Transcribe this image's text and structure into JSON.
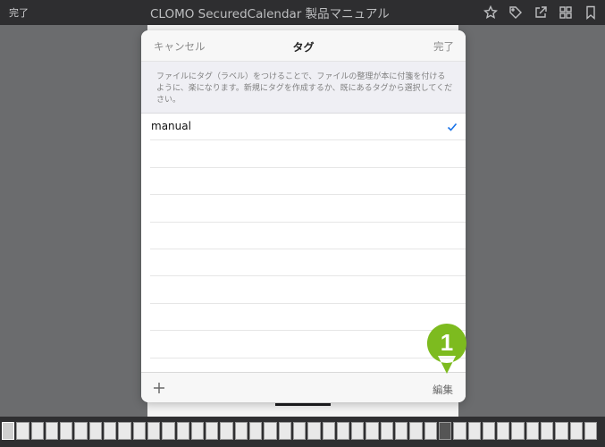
{
  "topbar": {
    "done_label": "完了",
    "title": "CLOMO SecuredCalendar 製品マニュアル",
    "icons": [
      "star-icon",
      "tag-icon",
      "share-icon",
      "grid-icon",
      "bookmark-icon"
    ]
  },
  "modal": {
    "cancel_label": "キャンセル",
    "title": "タグ",
    "done_label": "完了",
    "description": "ファイルにタグ（ラベル）をつけることで、ファイルの整理が本に付箋を付けるように、楽になります。新規にタグを作成するか、既にあるタグから選択してください。",
    "tags": [
      {
        "label": "manual",
        "checked": true
      },
      {
        "label": "",
        "checked": false
      },
      {
        "label": "",
        "checked": false
      },
      {
        "label": "",
        "checked": false
      },
      {
        "label": "",
        "checked": false
      },
      {
        "label": "",
        "checked": false
      },
      {
        "label": "",
        "checked": false
      },
      {
        "label": "",
        "checked": false
      },
      {
        "label": "",
        "checked": false
      }
    ],
    "add_icon": "plus-icon",
    "edit_label": "編集"
  },
  "annotation": {
    "number": "1",
    "color": "#7dbb1f"
  },
  "colors": {
    "check": "#1a73e8",
    "toolbar": "#2e2e30",
    "backdrop": "#6b6c6e"
  }
}
